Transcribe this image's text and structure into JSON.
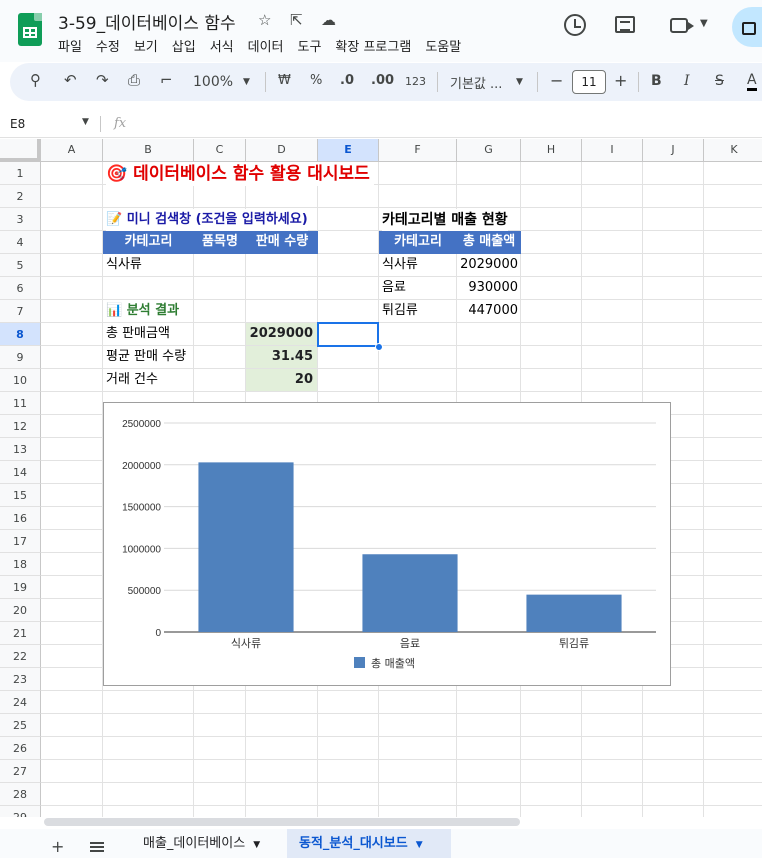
{
  "app": {
    "title": "3-59_데이터베이스 함수",
    "menu": [
      "파일",
      "수정",
      "보기",
      "삽입",
      "서식",
      "데이터",
      "도구",
      "확장 프로그램",
      "도움말"
    ]
  },
  "toolbar": {
    "zoom": "100%",
    "currency": "₩",
    "percent": "%",
    "dec_decrease": ".0",
    "dec_increase": ".00",
    "number_format": "123",
    "font": "기본값 ...",
    "font_size": "11",
    "minus": "−",
    "plus": "+",
    "bold": "B",
    "italic": "I",
    "strike": "S",
    "text_color": "A"
  },
  "formula_bar": {
    "name_box": "E8",
    "fx": "fx",
    "formula": ""
  },
  "columns": [
    "A",
    "B",
    "C",
    "D",
    "E",
    "F",
    "G",
    "H",
    "I",
    "J",
    "K"
  ],
  "rows": [
    "1",
    "2",
    "3",
    "4",
    "5",
    "6",
    "7",
    "8",
    "9",
    "10",
    "11",
    "12",
    "13",
    "14",
    "15",
    "16",
    "17",
    "18",
    "19",
    "20",
    "21",
    "22",
    "23",
    "24",
    "25",
    "26",
    "27",
    "28",
    "29"
  ],
  "selected_cell": "E8",
  "sheet": {
    "title": "🎯 데이터베이스 함수 활용 대시보드",
    "search_title": "📝 미니 검색창 (조건을 입력하세요)",
    "search_headers": [
      "카테고리",
      "품목명",
      "판매 수량"
    ],
    "search_values": [
      "식사류",
      "",
      ""
    ],
    "result_title": "📊 분석 결과",
    "results": [
      {
        "label": "총 판매금액",
        "value": "2029000"
      },
      {
        "label": "평균 판매 수량",
        "value": "31.45"
      },
      {
        "label": "거래 건수",
        "value": "20"
      }
    ],
    "category_title": "카테고리별 매출 현황",
    "category_headers": [
      "카테고리",
      "총 매출액"
    ],
    "category_rows": [
      {
        "category": "식사류",
        "amount": "2029000"
      },
      {
        "category": "음료",
        "amount": "930000"
      },
      {
        "category": "튀김류",
        "amount": "447000"
      }
    ]
  },
  "chart_data": {
    "type": "bar",
    "categories": [
      "식사류",
      "음료",
      "튀김류"
    ],
    "series": [
      {
        "name": "총 매출액",
        "values": [
          2029000,
          930000,
          447000
        ],
        "color": "#4f81bd"
      }
    ],
    "ylim": [
      0,
      2500000
    ],
    "yticks": [
      "2500000",
      "2000000",
      "1500000",
      "1000000",
      "500000",
      "0"
    ],
    "legend": "bottom",
    "grid": true
  },
  "sheets": [
    {
      "name": "매출_데이터베이스",
      "active": false
    },
    {
      "name": "동적_분석_대시보드",
      "active": true
    }
  ]
}
